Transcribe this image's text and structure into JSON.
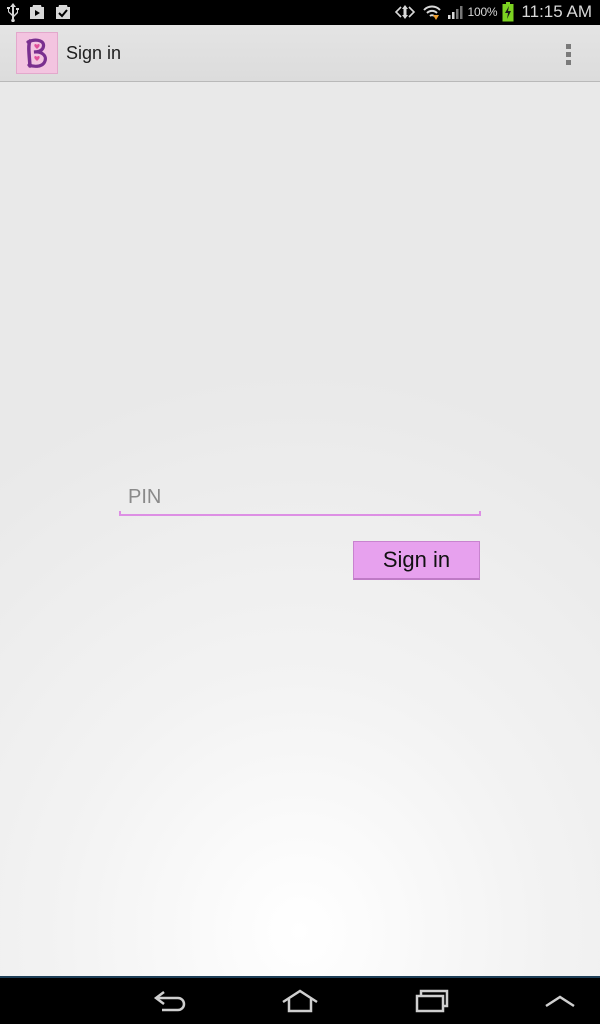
{
  "status_bar": {
    "icons_left": [
      "usb-icon",
      "play-store-icon",
      "task-check-icon"
    ],
    "icons_right": [
      "data-sync-icon",
      "wifi-icon",
      "signal-icon",
      "battery-charging-icon"
    ],
    "battery_percent": "100%",
    "time": "11:15 AM"
  },
  "action_bar": {
    "title": "Sign in",
    "logo_icon": "app-logo-b-heart-icon",
    "overflow_icon": "overflow-menu-icon"
  },
  "form": {
    "pin_placeholder": "PIN",
    "pin_value": "",
    "signin_label": "Sign in"
  },
  "nav_bar": {
    "buttons": [
      "back-icon",
      "home-icon",
      "recent-apps-icon",
      "chevron-up-icon"
    ]
  },
  "colors": {
    "accent": "#e7a1ee",
    "accent_line": "#dd8fe4",
    "logo_bg": "#f3c4e0",
    "logo_letter": "#7a2f8f",
    "status_bar_bg": "#000000",
    "battery_green": "#7cd321"
  }
}
